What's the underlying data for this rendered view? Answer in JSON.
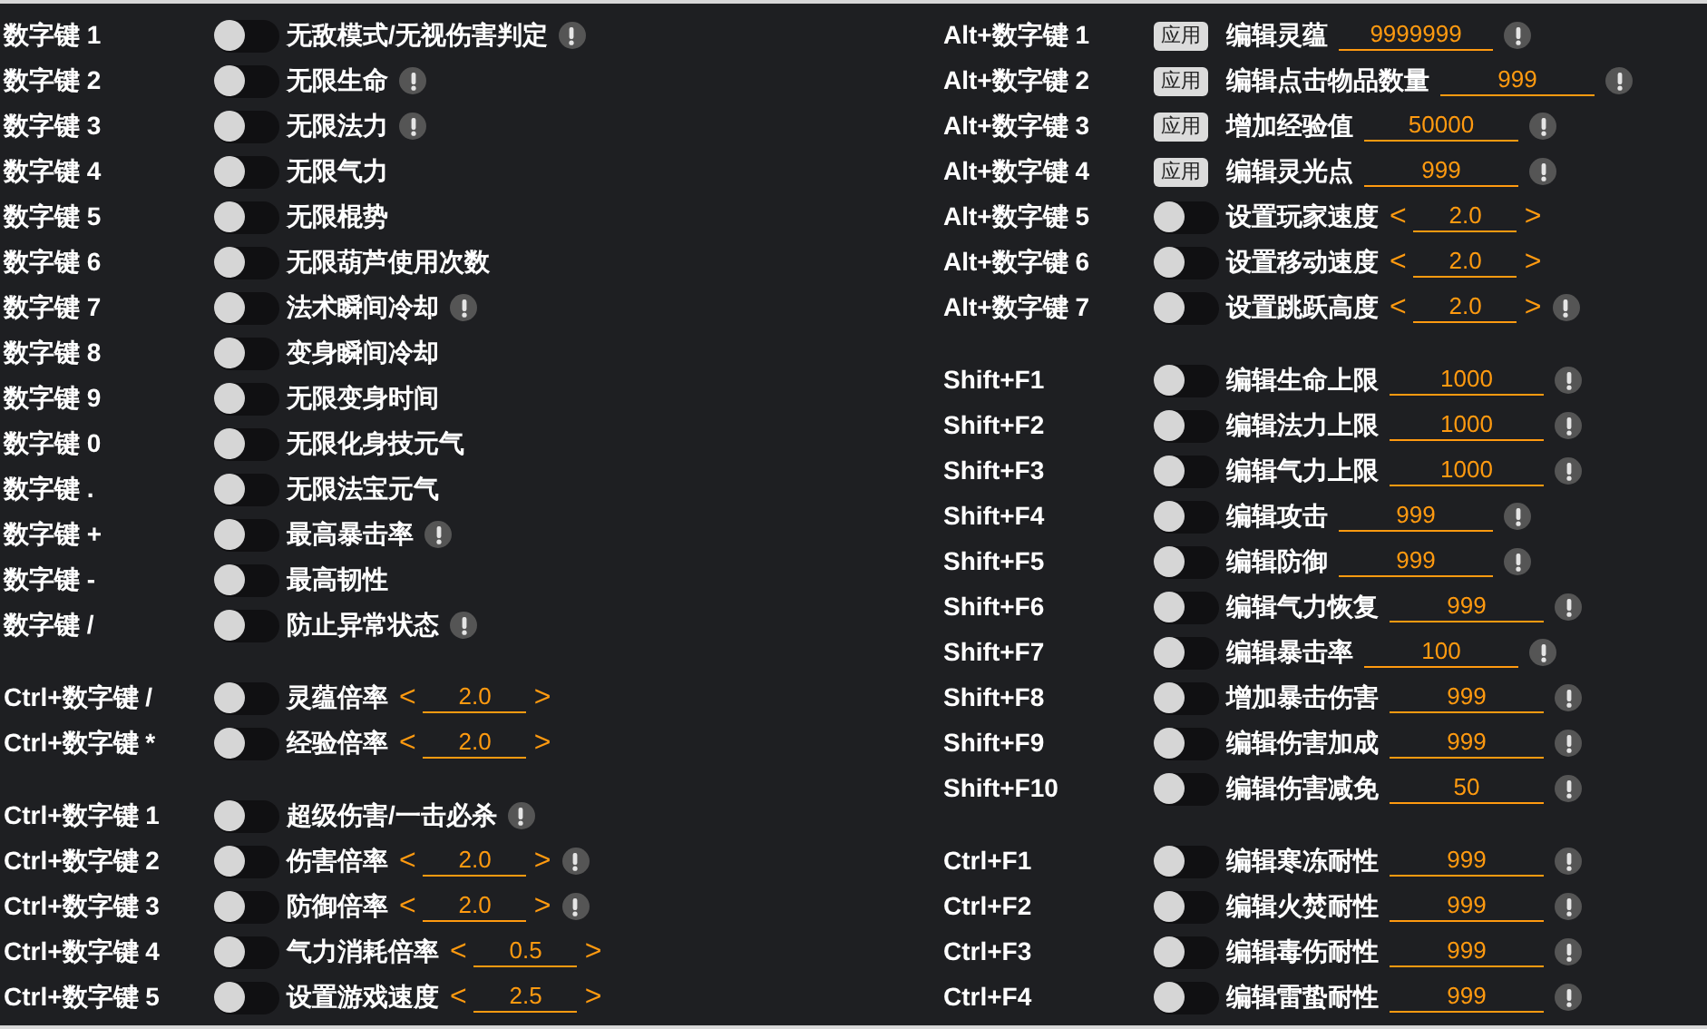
{
  "columns": [
    {
      "groups": [
        {
          "rows": [
            {
              "key": "数字键 1",
              "kind": "toggle",
              "on": false,
              "label": "无敌模式/无视伤害判定",
              "warning": true
            },
            {
              "key": "数字键 2",
              "kind": "toggle",
              "on": false,
              "label": "无限生命",
              "warning": true
            },
            {
              "key": "数字键 3",
              "kind": "toggle",
              "on": false,
              "label": "无限法力",
              "warning": true
            },
            {
              "key": "数字键 4",
              "kind": "toggle",
              "on": false,
              "label": "无限气力",
              "warning": false
            },
            {
              "key": "数字键 5",
              "kind": "toggle",
              "on": false,
              "label": "无限棍势",
              "warning": false
            },
            {
              "key": "数字键 6",
              "kind": "toggle",
              "on": false,
              "label": "无限葫芦使用次数",
              "warning": false
            },
            {
              "key": "数字键 7",
              "kind": "toggle",
              "on": false,
              "label": "法术瞬间冷却",
              "warning": true
            },
            {
              "key": "数字键 8",
              "kind": "toggle",
              "on": false,
              "label": "变身瞬间冷却",
              "warning": false
            },
            {
              "key": "数字键 9",
              "kind": "toggle",
              "on": false,
              "label": "无限变身时间",
              "warning": false
            },
            {
              "key": "数字键 0",
              "kind": "toggle",
              "on": false,
              "label": "无限化身技元气",
              "warning": false
            },
            {
              "key": "数字键 .",
              "kind": "toggle",
              "on": false,
              "label": "无限法宝元气",
              "warning": false
            },
            {
              "key": "数字键 +",
              "kind": "toggle",
              "on": false,
              "label": "最高暴击率",
              "warning": true
            },
            {
              "key": "数字键 -",
              "kind": "toggle",
              "on": false,
              "label": "最高韧性",
              "warning": false
            },
            {
              "key": "数字键 /",
              "kind": "toggle",
              "on": false,
              "label": "防止异常状态",
              "warning": true
            }
          ]
        },
        {
          "rows": [
            {
              "key": "Ctrl+数字键 /",
              "kind": "stepper",
              "on": false,
              "label": "灵蕴倍率",
              "decrease": "<",
              "value": "2.0",
              "increase": ">",
              "warning": false
            },
            {
              "key": "Ctrl+数字键 *",
              "kind": "stepper",
              "on": false,
              "label": "经验倍率",
              "decrease": "<",
              "value": "2.0",
              "increase": ">",
              "warning": false
            }
          ]
        },
        {
          "rows": [
            {
              "key": "Ctrl+数字键 1",
              "kind": "toggle",
              "on": false,
              "label": "超级伤害/一击必杀",
              "warning": true
            },
            {
              "key": "Ctrl+数字键 2",
              "kind": "stepper",
              "on": false,
              "label": "伤害倍率",
              "decrease": "<",
              "value": "2.0",
              "increase": ">",
              "warning": true
            },
            {
              "key": "Ctrl+数字键 3",
              "kind": "stepper",
              "on": false,
              "label": "防御倍率",
              "decrease": "<",
              "value": "2.0",
              "increase": ">",
              "warning": true
            },
            {
              "key": "Ctrl+数字键 4",
              "kind": "stepper",
              "on": false,
              "label": "气力消耗倍率",
              "decrease": "<",
              "value": "0.5",
              "increase": ">",
              "warning": false
            },
            {
              "key": "Ctrl+数字键 5",
              "kind": "stepper",
              "on": false,
              "label": "设置游戏速度",
              "decrease": "<",
              "value": "2.5",
              "increase": ">",
              "warning": false
            }
          ]
        }
      ]
    },
    {
      "groups": [
        {
          "rows": [
            {
              "key": "Alt+数字键 1",
              "kind": "apply",
              "button": "应用",
              "label": "编辑灵蕴",
              "value": "9999999",
              "warning": true
            },
            {
              "key": "Alt+数字键 2",
              "kind": "apply",
              "button": "应用",
              "label": "编辑点击物品数量",
              "value": "999",
              "warning": true
            },
            {
              "key": "Alt+数字键 3",
              "kind": "apply",
              "button": "应用",
              "label": "增加经验值",
              "value": "50000",
              "warning": true
            },
            {
              "key": "Alt+数字键 4",
              "kind": "apply",
              "button": "应用",
              "label": "编辑灵光点",
              "value": "999",
              "warning": true
            },
            {
              "key": "Alt+数字键 5",
              "kind": "stepper",
              "on": false,
              "label": "设置玩家速度",
              "decrease": "<",
              "value": "2.0",
              "increase": ">",
              "warning": false
            },
            {
              "key": "Alt+数字键 6",
              "kind": "stepper",
              "on": false,
              "label": "设置移动速度",
              "decrease": "<",
              "value": "2.0",
              "increase": ">",
              "warning": false
            },
            {
              "key": "Alt+数字键 7",
              "kind": "stepper",
              "on": false,
              "label": "设置跳跃高度",
              "decrease": "<",
              "value": "2.0",
              "increase": ">",
              "warning": true
            }
          ]
        },
        {
          "rows": [
            {
              "key": "Shift+F1",
              "kind": "field",
              "on": false,
              "label": "编辑生命上限",
              "value": "1000",
              "warning": true
            },
            {
              "key": "Shift+F2",
              "kind": "field",
              "on": false,
              "label": "编辑法力上限",
              "value": "1000",
              "warning": true
            },
            {
              "key": "Shift+F3",
              "kind": "field",
              "on": false,
              "label": "编辑气力上限",
              "value": "1000",
              "warning": true
            },
            {
              "key": "Shift+F4",
              "kind": "field",
              "on": false,
              "label": "编辑攻击",
              "value": "999",
              "warning": true
            },
            {
              "key": "Shift+F5",
              "kind": "field",
              "on": false,
              "label": "编辑防御",
              "value": "999",
              "warning": true
            },
            {
              "key": "Shift+F6",
              "kind": "field",
              "on": false,
              "label": "编辑气力恢复",
              "value": "999",
              "warning": true
            },
            {
              "key": "Shift+F7",
              "kind": "field",
              "on": false,
              "label": "编辑暴击率",
              "value": "100",
              "warning": true
            },
            {
              "key": "Shift+F8",
              "kind": "field",
              "on": false,
              "label": "增加暴击伤害",
              "value": "999",
              "warning": true
            },
            {
              "key": "Shift+F9",
              "kind": "field",
              "on": false,
              "label": "编辑伤害加成",
              "value": "999",
              "warning": true
            },
            {
              "key": "Shift+F10",
              "kind": "field",
              "on": false,
              "label": "编辑伤害减免",
              "value": "50",
              "warning": true
            }
          ]
        },
        {
          "rows": [
            {
              "key": "Ctrl+F1",
              "kind": "field",
              "on": false,
              "label": "编辑寒冻耐性",
              "value": "999",
              "warning": true
            },
            {
              "key": "Ctrl+F2",
              "kind": "field",
              "on": false,
              "label": "编辑火焚耐性",
              "value": "999",
              "warning": true
            },
            {
              "key": "Ctrl+F3",
              "kind": "field",
              "on": false,
              "label": "编辑毒伤耐性",
              "value": "999",
              "warning": true
            },
            {
              "key": "Ctrl+F4",
              "kind": "field",
              "on": false,
              "label": "编辑雷蛰耐性",
              "value": "999",
              "warning": true
            }
          ]
        }
      ]
    }
  ]
}
